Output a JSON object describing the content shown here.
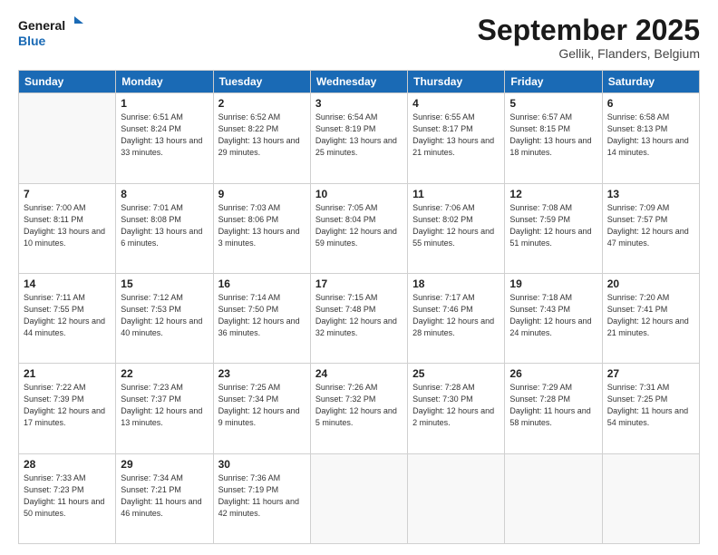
{
  "logo": {
    "line1": "General",
    "line2": "Blue"
  },
  "title": "September 2025",
  "location": "Gellik, Flanders, Belgium",
  "header_days": [
    "Sunday",
    "Monday",
    "Tuesday",
    "Wednesday",
    "Thursday",
    "Friday",
    "Saturday"
  ],
  "weeks": [
    [
      {
        "day": "",
        "sunrise": "",
        "sunset": "",
        "daylight": ""
      },
      {
        "day": "1",
        "sunrise": "Sunrise: 6:51 AM",
        "sunset": "Sunset: 8:24 PM",
        "daylight": "Daylight: 13 hours and 33 minutes."
      },
      {
        "day": "2",
        "sunrise": "Sunrise: 6:52 AM",
        "sunset": "Sunset: 8:22 PM",
        "daylight": "Daylight: 13 hours and 29 minutes."
      },
      {
        "day": "3",
        "sunrise": "Sunrise: 6:54 AM",
        "sunset": "Sunset: 8:19 PM",
        "daylight": "Daylight: 13 hours and 25 minutes."
      },
      {
        "day": "4",
        "sunrise": "Sunrise: 6:55 AM",
        "sunset": "Sunset: 8:17 PM",
        "daylight": "Daylight: 13 hours and 21 minutes."
      },
      {
        "day": "5",
        "sunrise": "Sunrise: 6:57 AM",
        "sunset": "Sunset: 8:15 PM",
        "daylight": "Daylight: 13 hours and 18 minutes."
      },
      {
        "day": "6",
        "sunrise": "Sunrise: 6:58 AM",
        "sunset": "Sunset: 8:13 PM",
        "daylight": "Daylight: 13 hours and 14 minutes."
      }
    ],
    [
      {
        "day": "7",
        "sunrise": "Sunrise: 7:00 AM",
        "sunset": "Sunset: 8:11 PM",
        "daylight": "Daylight: 13 hours and 10 minutes."
      },
      {
        "day": "8",
        "sunrise": "Sunrise: 7:01 AM",
        "sunset": "Sunset: 8:08 PM",
        "daylight": "Daylight: 13 hours and 6 minutes."
      },
      {
        "day": "9",
        "sunrise": "Sunrise: 7:03 AM",
        "sunset": "Sunset: 8:06 PM",
        "daylight": "Daylight: 13 hours and 3 minutes."
      },
      {
        "day": "10",
        "sunrise": "Sunrise: 7:05 AM",
        "sunset": "Sunset: 8:04 PM",
        "daylight": "Daylight: 12 hours and 59 minutes."
      },
      {
        "day": "11",
        "sunrise": "Sunrise: 7:06 AM",
        "sunset": "Sunset: 8:02 PM",
        "daylight": "Daylight: 12 hours and 55 minutes."
      },
      {
        "day": "12",
        "sunrise": "Sunrise: 7:08 AM",
        "sunset": "Sunset: 7:59 PM",
        "daylight": "Daylight: 12 hours and 51 minutes."
      },
      {
        "day": "13",
        "sunrise": "Sunrise: 7:09 AM",
        "sunset": "Sunset: 7:57 PM",
        "daylight": "Daylight: 12 hours and 47 minutes."
      }
    ],
    [
      {
        "day": "14",
        "sunrise": "Sunrise: 7:11 AM",
        "sunset": "Sunset: 7:55 PM",
        "daylight": "Daylight: 12 hours and 44 minutes."
      },
      {
        "day": "15",
        "sunrise": "Sunrise: 7:12 AM",
        "sunset": "Sunset: 7:53 PM",
        "daylight": "Daylight: 12 hours and 40 minutes."
      },
      {
        "day": "16",
        "sunrise": "Sunrise: 7:14 AM",
        "sunset": "Sunset: 7:50 PM",
        "daylight": "Daylight: 12 hours and 36 minutes."
      },
      {
        "day": "17",
        "sunrise": "Sunrise: 7:15 AM",
        "sunset": "Sunset: 7:48 PM",
        "daylight": "Daylight: 12 hours and 32 minutes."
      },
      {
        "day": "18",
        "sunrise": "Sunrise: 7:17 AM",
        "sunset": "Sunset: 7:46 PM",
        "daylight": "Daylight: 12 hours and 28 minutes."
      },
      {
        "day": "19",
        "sunrise": "Sunrise: 7:18 AM",
        "sunset": "Sunset: 7:43 PM",
        "daylight": "Daylight: 12 hours and 24 minutes."
      },
      {
        "day": "20",
        "sunrise": "Sunrise: 7:20 AM",
        "sunset": "Sunset: 7:41 PM",
        "daylight": "Daylight: 12 hours and 21 minutes."
      }
    ],
    [
      {
        "day": "21",
        "sunrise": "Sunrise: 7:22 AM",
        "sunset": "Sunset: 7:39 PM",
        "daylight": "Daylight: 12 hours and 17 minutes."
      },
      {
        "day": "22",
        "sunrise": "Sunrise: 7:23 AM",
        "sunset": "Sunset: 7:37 PM",
        "daylight": "Daylight: 12 hours and 13 minutes."
      },
      {
        "day": "23",
        "sunrise": "Sunrise: 7:25 AM",
        "sunset": "Sunset: 7:34 PM",
        "daylight": "Daylight: 12 hours and 9 minutes."
      },
      {
        "day": "24",
        "sunrise": "Sunrise: 7:26 AM",
        "sunset": "Sunset: 7:32 PM",
        "daylight": "Daylight: 12 hours and 5 minutes."
      },
      {
        "day": "25",
        "sunrise": "Sunrise: 7:28 AM",
        "sunset": "Sunset: 7:30 PM",
        "daylight": "Daylight: 12 hours and 2 minutes."
      },
      {
        "day": "26",
        "sunrise": "Sunrise: 7:29 AM",
        "sunset": "Sunset: 7:28 PM",
        "daylight": "Daylight: 11 hours and 58 minutes."
      },
      {
        "day": "27",
        "sunrise": "Sunrise: 7:31 AM",
        "sunset": "Sunset: 7:25 PM",
        "daylight": "Daylight: 11 hours and 54 minutes."
      }
    ],
    [
      {
        "day": "28",
        "sunrise": "Sunrise: 7:33 AM",
        "sunset": "Sunset: 7:23 PM",
        "daylight": "Daylight: 11 hours and 50 minutes."
      },
      {
        "day": "29",
        "sunrise": "Sunrise: 7:34 AM",
        "sunset": "Sunset: 7:21 PM",
        "daylight": "Daylight: 11 hours and 46 minutes."
      },
      {
        "day": "30",
        "sunrise": "Sunrise: 7:36 AM",
        "sunset": "Sunset: 7:19 PM",
        "daylight": "Daylight: 11 hours and 42 minutes."
      },
      {
        "day": "",
        "sunrise": "",
        "sunset": "",
        "daylight": ""
      },
      {
        "day": "",
        "sunrise": "",
        "sunset": "",
        "daylight": ""
      },
      {
        "day": "",
        "sunrise": "",
        "sunset": "",
        "daylight": ""
      },
      {
        "day": "",
        "sunrise": "",
        "sunset": "",
        "daylight": ""
      }
    ]
  ]
}
